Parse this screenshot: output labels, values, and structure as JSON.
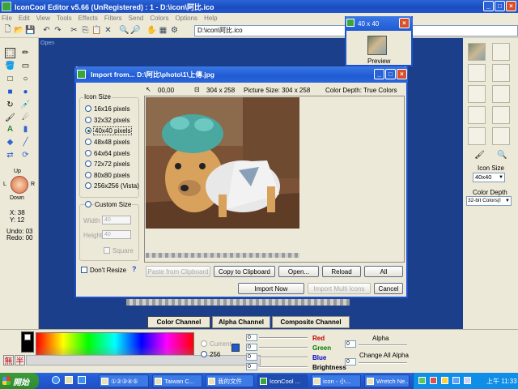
{
  "app": {
    "title": "IconCool Editor v5.66 (UnRegistered) : 1 - D:\\icon\\阿比.ico",
    "menu": [
      "File",
      "Edit",
      "View",
      "Tools",
      "Effects",
      "Filters",
      "Send",
      "Colors",
      "Options",
      "Help"
    ],
    "path": "D:\\icon\\阿比.ico",
    "open_label": "Open"
  },
  "left_panel": {
    "direction": {
      "up": "Up",
      "down": "Down",
      "left": "L",
      "right": "R"
    },
    "coords": {
      "x": "X: 38",
      "y": "Y: 12"
    },
    "undo": "Undo: 03",
    "redo": "Redo: 00"
  },
  "preview": {
    "title": "40 x 40",
    "label": "Preview"
  },
  "right_panel": {
    "icon_size_label": "Icon Size",
    "icon_size_value": "40x40",
    "color_depth_label": "Color Depth",
    "color_depth_value": "32-bit Colors(I"
  },
  "dialog": {
    "title": "Import from... D:\\阿比\\photo\\1\\上傳.jpg",
    "info": {
      "coords": "00,00",
      "dims": "304 x 258",
      "picture_size": "Picture Size: 304 x 258",
      "color_depth": "Color Depth: True Colors"
    },
    "icon_size_group": "Icon Size",
    "sizes": [
      "16x16 pixels",
      "32x32 pixels",
      "40x40 pixels",
      "48x48 pixels",
      "64x64 pixels",
      "72x72 pixels",
      "80x80 pixels",
      "256x256 (Vista)"
    ],
    "selected_size_index": 2,
    "custom_size": "Custom Size",
    "width_label": "Width",
    "width_value": "40",
    "height_label": "Height",
    "height_value": "40",
    "square_label": "Square",
    "dont_resize": "Don't Resize",
    "help": "?",
    "buttons": {
      "paste": "Paste from Clipboard",
      "copy": "Copy to Clipboard",
      "open": "Open...",
      "reload": "Reload",
      "all": "All",
      "import_now": "Import Now",
      "import_multi": "Import Multi Icons",
      "cancel": "Cancel"
    }
  },
  "channels": {
    "tabs": [
      "Color Channel",
      "Alpha Channel",
      "Composite Channel"
    ]
  },
  "color_panel": {
    "current_label": "Current",
    "colors_label": "256",
    "red_label": "Red",
    "green_label": "Green",
    "blue_label": "Blue",
    "brightness_label": "Brightness",
    "alpha_label": "Alpha",
    "change_all_alpha": "Change All Alpha",
    "red_value": "0",
    "green_value": "0",
    "blue_value": "0",
    "brightness_value": "0",
    "alpha_value": "0",
    "change_all_value": "0",
    "ime": [
      "無",
      "半"
    ],
    "colors": {
      "red": "#c00000",
      "green": "#008000",
      "blue": "#0000c0"
    }
  },
  "taskbar": {
    "start": "開始",
    "tasks": [
      "①②③④⑤",
      "Taiwan C...",
      "我的文件",
      "IconCool ...",
      "icon - 小...",
      "Wretch Ne..."
    ],
    "clock": "上午 11:33"
  }
}
